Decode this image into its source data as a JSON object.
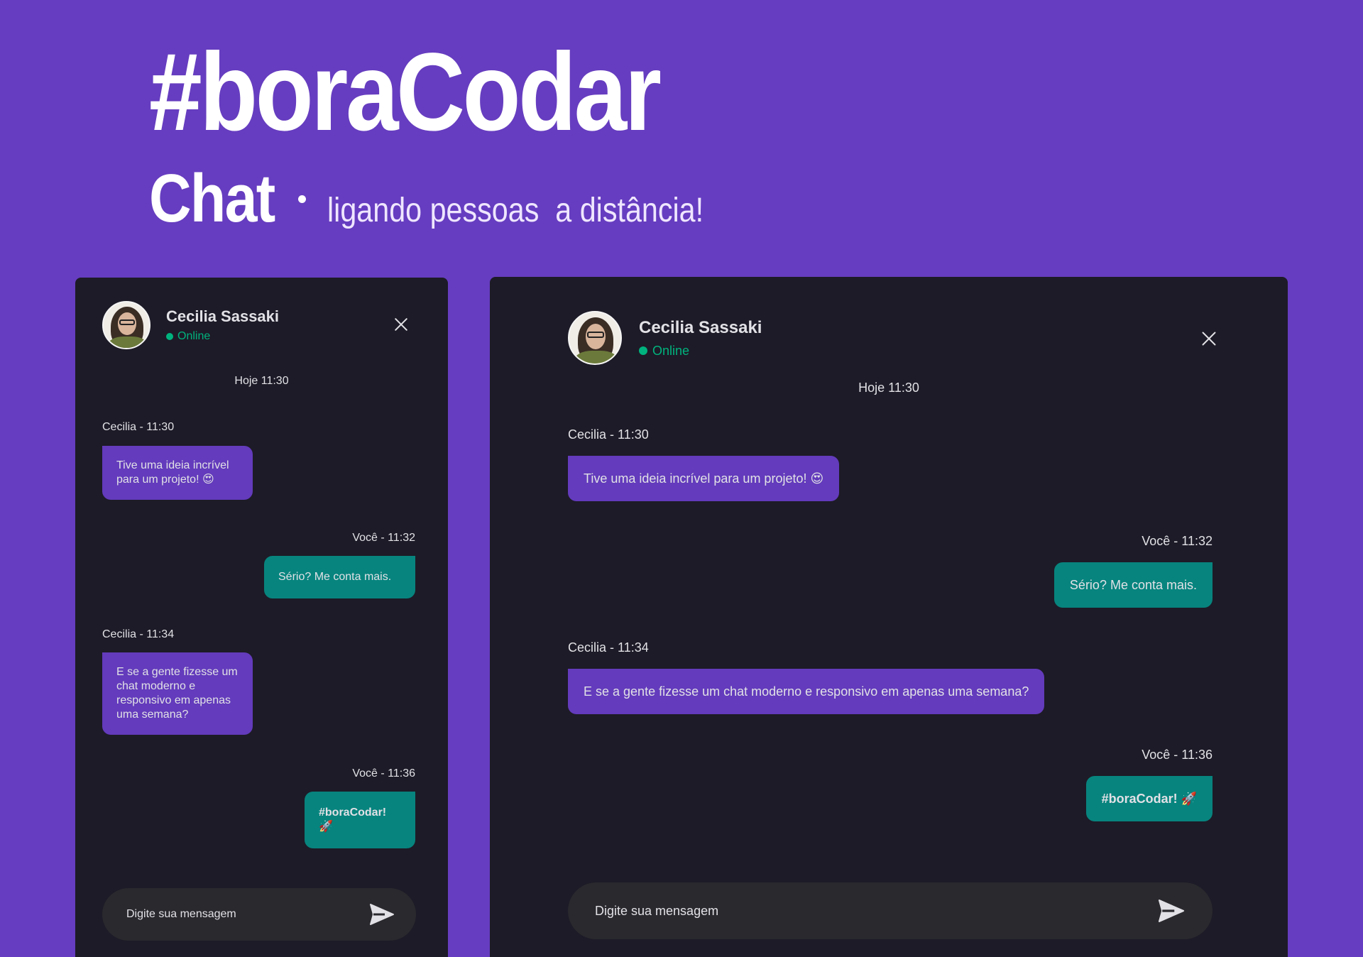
{
  "hero": {
    "title": "#boraCodar",
    "subtitle": "Chat",
    "tagline": "ligando pessoas  a distância!"
  },
  "contact": {
    "name": "Cecilia Sassaki",
    "status": "Online"
  },
  "chat": {
    "day_separator": "Hoje 11:30",
    "messages": [
      {
        "from": "them",
        "meta": "Cecilia - 11:30",
        "text": "Tive uma ideia incrível para um projeto! 😍"
      },
      {
        "from": "me",
        "meta": "Você - 11:32",
        "text": "Sério? Me conta mais."
      },
      {
        "from": "them",
        "meta": "Cecilia - 11:34",
        "text": "E se a gente fizesse um chat moderno e responsivo em apenas uma semana?"
      },
      {
        "from": "me",
        "meta": "Você - 11:36",
        "text": "#boraCodar! 🚀"
      }
    ]
  },
  "composer": {
    "placeholder": "Digite sua mensagem"
  },
  "icons": {
    "close": "close-icon",
    "send": "send-icon"
  },
  "colors": {
    "background": "#663dc0",
    "panel": "#1d1b27",
    "bubble_them": "#633bbc",
    "bubble_me": "#07847e",
    "online": "#00b37e",
    "composer": "#29292e"
  }
}
